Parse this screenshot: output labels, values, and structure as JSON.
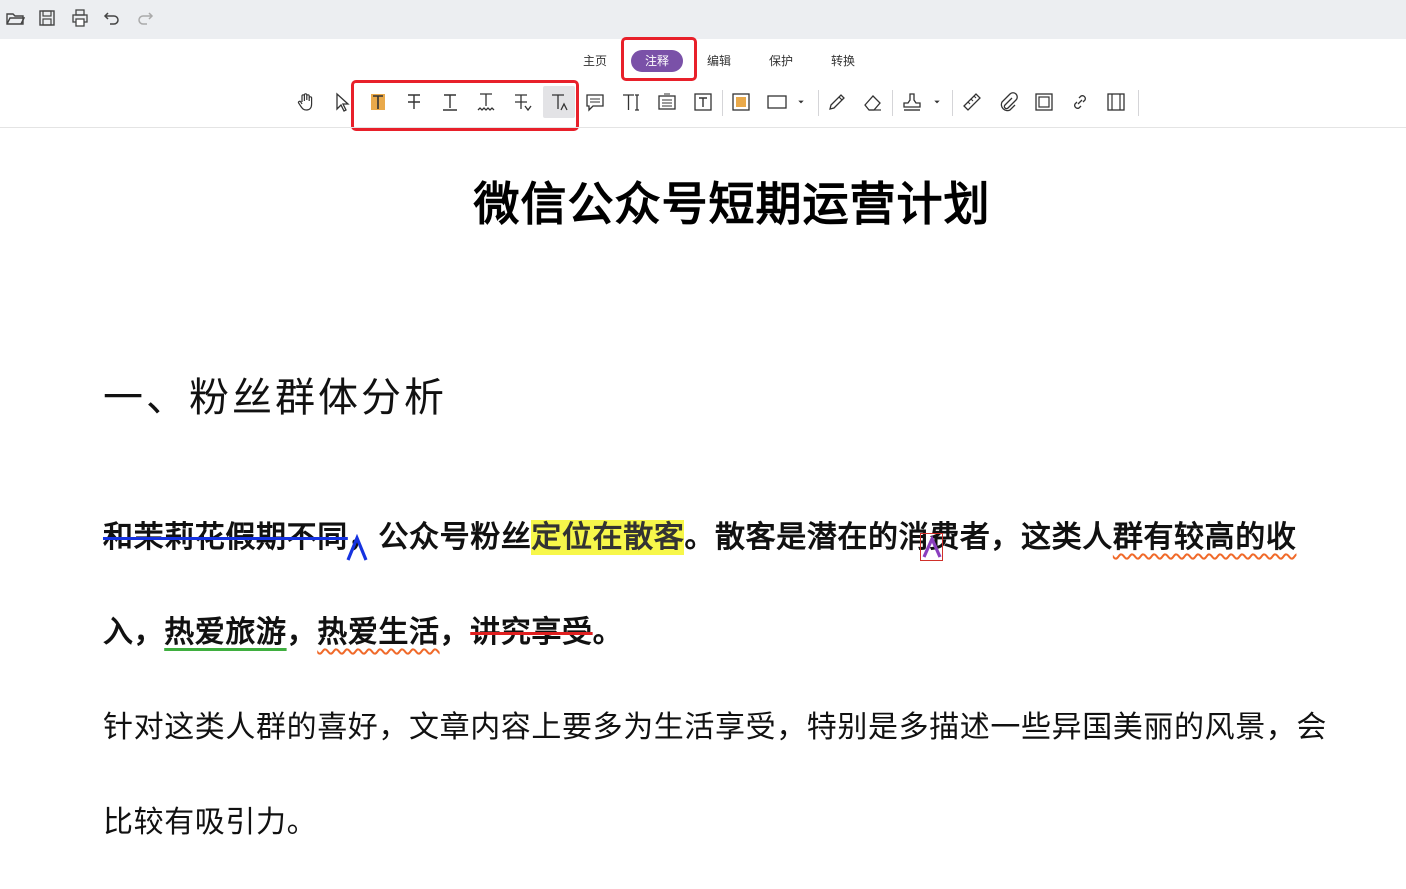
{
  "quick_access": {
    "icons": [
      "open-folder-icon",
      "save-icon",
      "print-icon",
      "undo-icon",
      "redo-icon"
    ]
  },
  "ribbon": {
    "tabs": [
      {
        "label": "主页",
        "active": false
      },
      {
        "label": "注释",
        "active": true
      },
      {
        "label": "编辑",
        "active": false
      },
      {
        "label": "保护",
        "active": false
      },
      {
        "label": "转换",
        "active": false
      }
    ],
    "accent_color": "#7a51a8",
    "callout_color": "#e8202a"
  },
  "toolbar": {
    "tools": [
      "hand-tool-icon",
      "select-arrow-icon",
      "highlight-text-icon",
      "strikethrough-text-icon",
      "underline-text-icon",
      "squiggly-underline-icon",
      "replace-text-icon",
      "insert-text-icon",
      "note-icon",
      "typewriter-icon",
      "text-box-icon",
      "callout-icon",
      "area-highlight-icon",
      "rectangle-icon",
      "pencil-icon",
      "eraser-icon",
      "stamp-icon",
      "measure-icon",
      "attachment-icon",
      "image-annotation-icon",
      "link-icon",
      "film-icon"
    ]
  },
  "document": {
    "title": "微信公众号短期运营计划",
    "heading": "一、粉丝群体分析",
    "p1": {
      "struck": "和茉莉花假期不同",
      "comma1": "，",
      "after": "公众号粉丝",
      "highlighted": "定位在散客",
      "period": "。",
      "mid": "散客是潜在的消费者，这类人",
      "squiggly": "群有较高的收"
    },
    "p2": {
      "start": "入，",
      "underlined": "热爱旅游",
      "comma2": "，",
      "squiggly": "热爱生活",
      "comma3": "，",
      "struck": "讲究享受",
      "end": "。"
    },
    "p3": "针对这类人群的喜好，文章内容上要多为生活享受，特别是多描述一些异国美丽的风景，会",
    "p4": "比较有吸引力。",
    "colors": {
      "strike_blue": "#1633e0",
      "strike_red": "#e02020",
      "highlight": "#f7f74a",
      "squiggle": "#f06a2a",
      "underline_green": "#3fae3f",
      "insert_caret_purple": "#8a3fbf"
    }
  }
}
